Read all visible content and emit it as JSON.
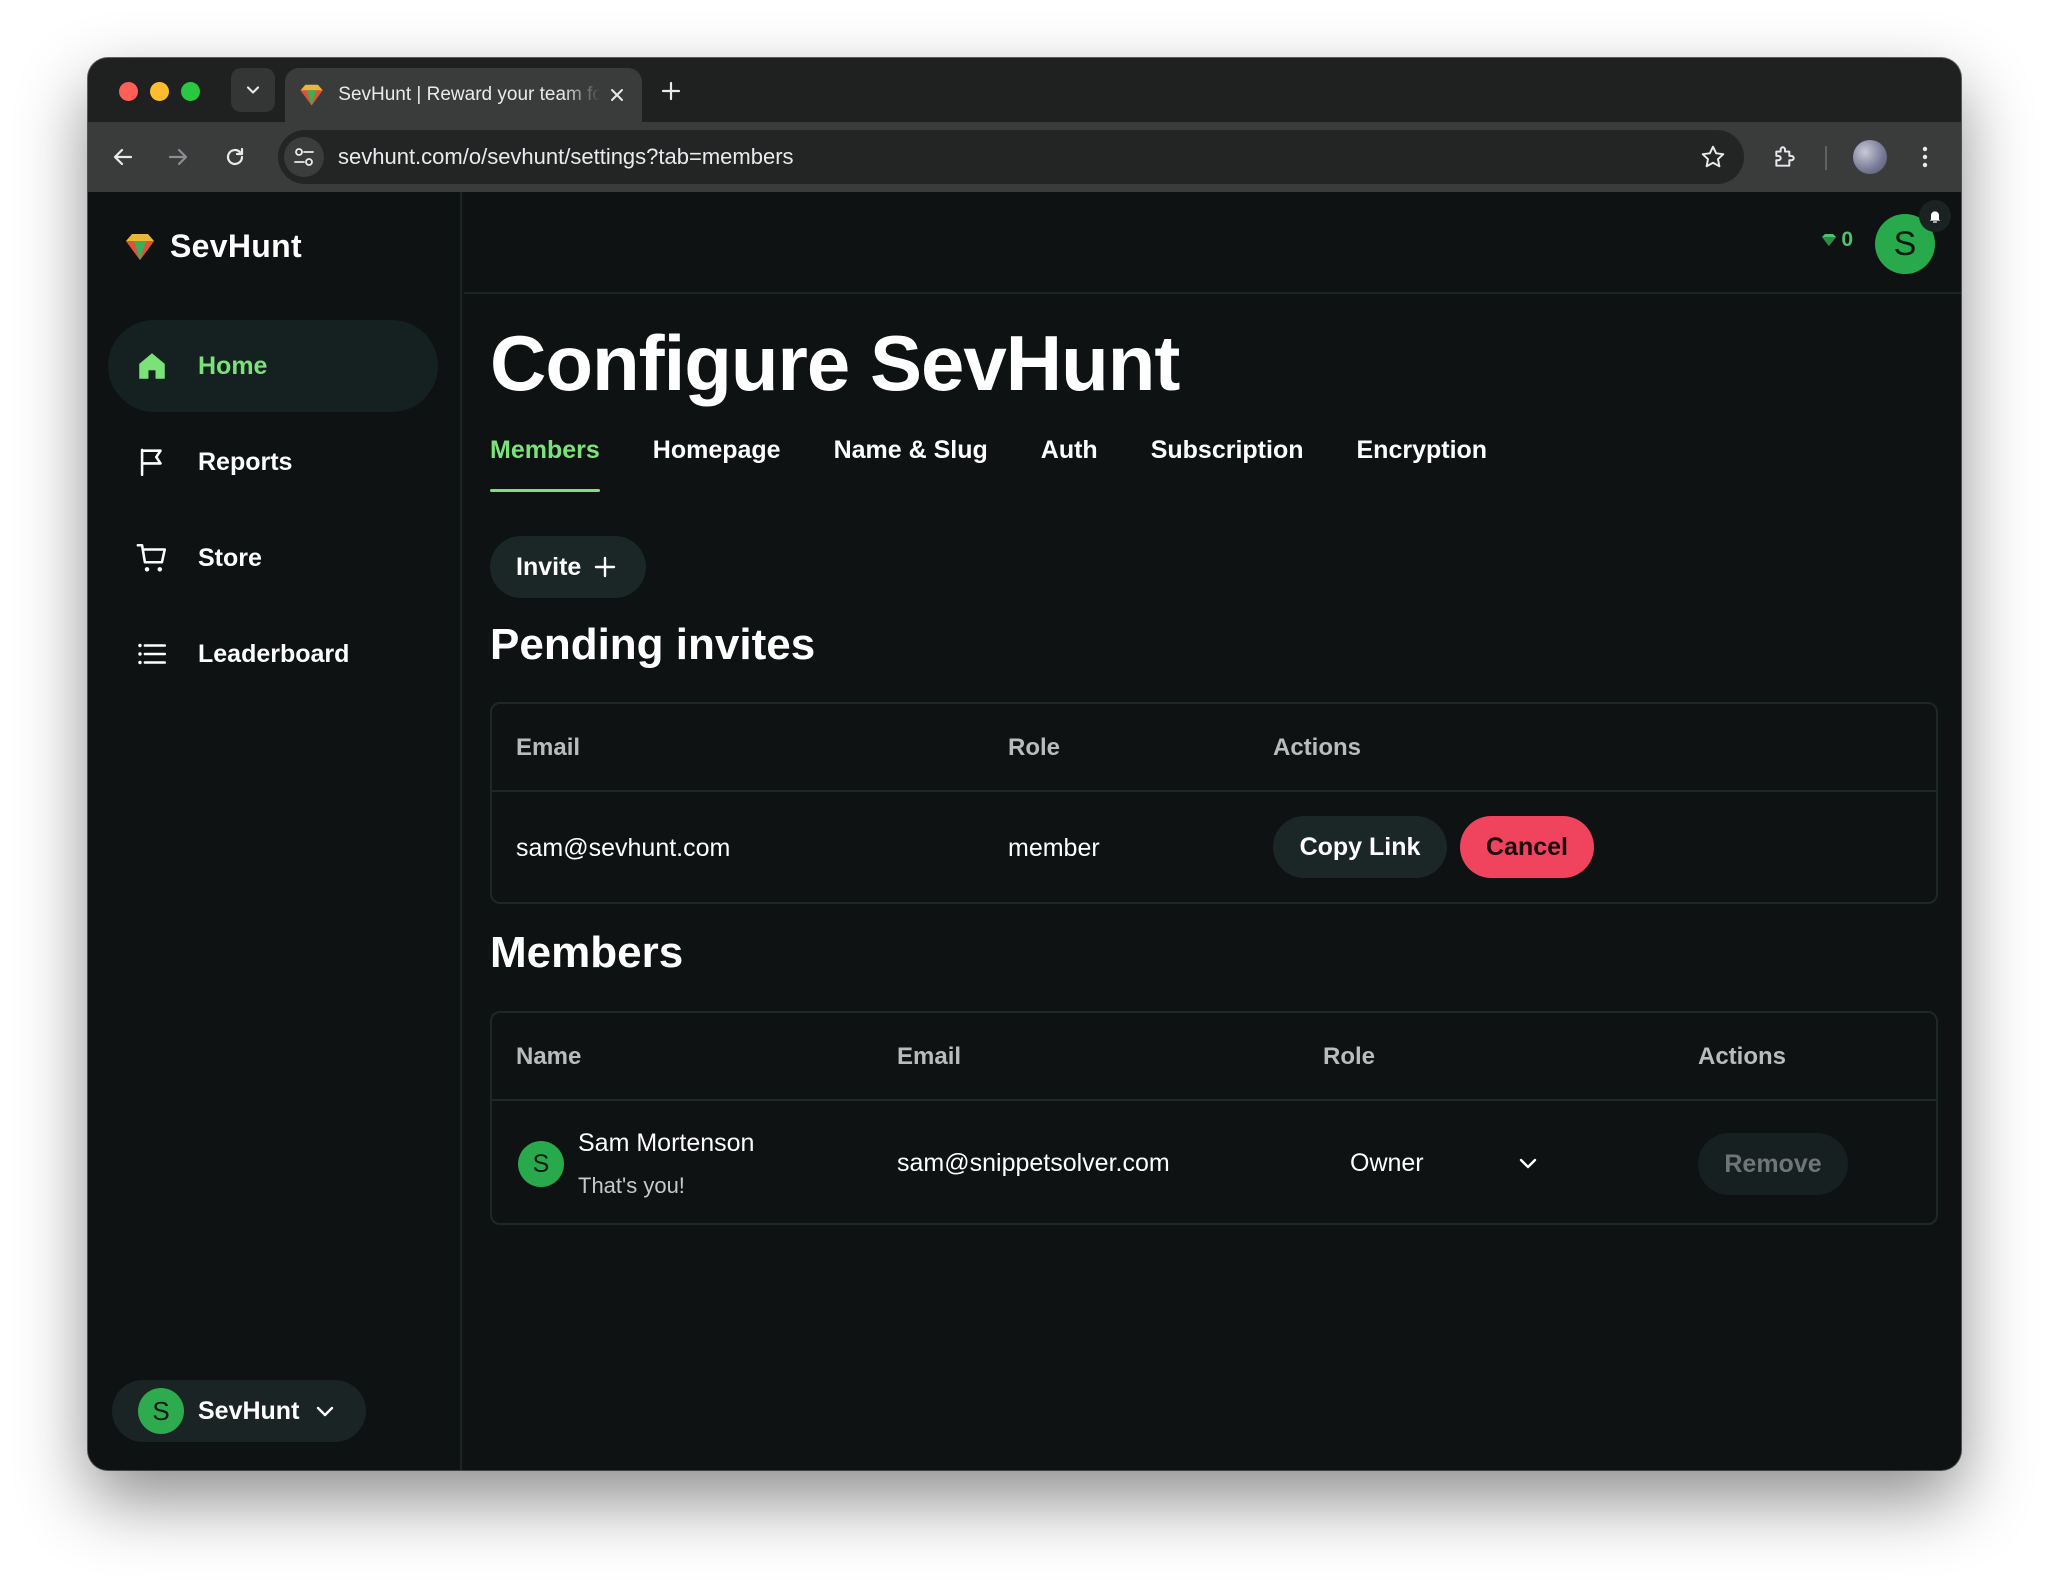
{
  "browser": {
    "tab_title": "SevHunt | Reward your team for finding bugs",
    "url": "sevhunt.com/o/sevhunt/settings?tab=members"
  },
  "brand": {
    "name": "SevHunt"
  },
  "sidebar": {
    "items": [
      {
        "label": "Home",
        "icon": "home-icon",
        "active": true
      },
      {
        "label": "Reports",
        "icon": "flag-icon",
        "active": false
      },
      {
        "label": "Store",
        "icon": "cart-icon",
        "active": false
      },
      {
        "label": "Leaderboard",
        "icon": "list-icon",
        "active": false
      }
    ],
    "org_switcher": {
      "avatar_letter": "S",
      "name": "SevHunt"
    }
  },
  "topbar": {
    "points": "0",
    "user_avatar_letter": "S"
  },
  "page": {
    "title": "Configure SevHunt",
    "tabs": [
      {
        "label": "Members",
        "active": true
      },
      {
        "label": "Homepage",
        "active": false
      },
      {
        "label": "Name & Slug",
        "active": false
      },
      {
        "label": "Auth",
        "active": false
      },
      {
        "label": "Subscription",
        "active": false
      },
      {
        "label": "Encryption",
        "active": false
      }
    ],
    "invite_label": "Invite"
  },
  "pending": {
    "title": "Pending invites",
    "columns": [
      "Email",
      "Role",
      "Actions"
    ],
    "rows": [
      {
        "email": "sam@sevhunt.com",
        "role": "member",
        "copy_label": "Copy Link",
        "cancel_label": "Cancel"
      }
    ]
  },
  "members": {
    "title": "Members",
    "columns": [
      "Name",
      "Email",
      "Role",
      "Actions"
    ],
    "rows": [
      {
        "avatar_letter": "S",
        "name": "Sam Mortenson",
        "subtitle": "That's you!",
        "email": "sam@snippetsolver.com",
        "role": "Owner",
        "remove_label": "Remove"
      }
    ]
  },
  "colors": {
    "accent": "#7be27a",
    "background": "#0e1212",
    "danger": "#f0435d",
    "avatar": "#27a94c"
  }
}
